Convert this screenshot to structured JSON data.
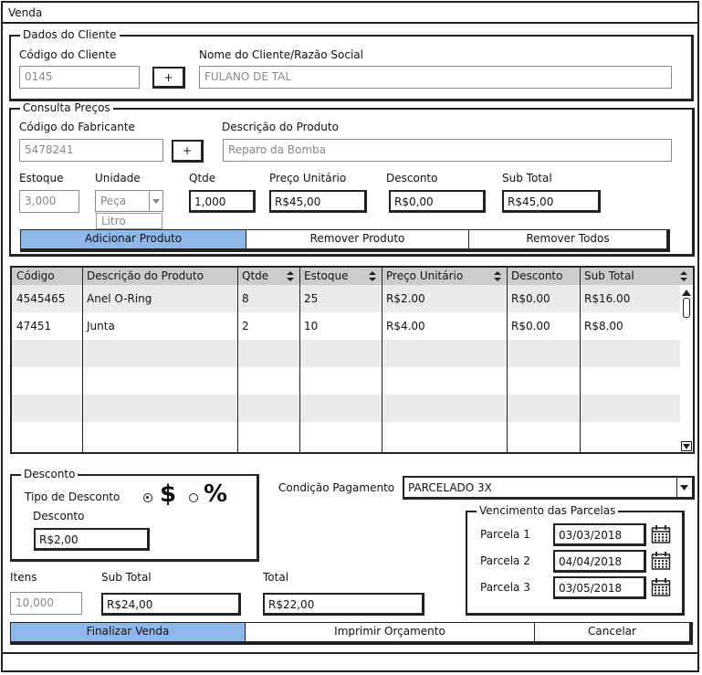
{
  "window": {
    "title": "Venda"
  },
  "cliente": {
    "legend": "Dados do Cliente",
    "codigo_label": "Código do Cliente",
    "codigo_value": "0145",
    "add_label": "+",
    "nome_label": "Nome do Cliente/Razão Social",
    "nome_value": "FULANO DE TAL"
  },
  "consulta": {
    "legend": "Consulta Preços",
    "fabricante_label": "Código do Fabricante",
    "fabricante_value": "5478241",
    "add_label": "+",
    "descricao_label": "Descrição do Produto",
    "descricao_value": "Reparo da Bomba",
    "estoque_label": "Estoque",
    "estoque_value": "3,000",
    "unidade_label": "Unidade",
    "unidade_value": "Peça",
    "unidade_option": "Litro",
    "qtde_label": "Qtde",
    "qtde_value": "1,000",
    "preco_label": "Preço Unitário",
    "preco_value": "R$45,00",
    "desconto_label": "Desconto",
    "desconto_value": "R$0,00",
    "subtotal_label": "Sub Total",
    "subtotal_value": "R$45,00",
    "actions": [
      "Adicionar Produto",
      "Remover Produto",
      "Remover Todos"
    ]
  },
  "grid": {
    "columns": [
      "Código",
      "Descrição do Produto",
      "Qtde",
      "Estoque",
      "Preço Unitário",
      "Desconto",
      "Sub Total"
    ],
    "rows": [
      [
        "4545465",
        "Anel O-Ring",
        "8",
        "25",
        "R$2.00",
        "R$0.00",
        "R$16.00"
      ],
      [
        "47451",
        "Junta",
        "2",
        "10",
        "R$4.00",
        "R$0.00",
        "R$8.00"
      ]
    ]
  },
  "desconto": {
    "legend": "Desconto",
    "tipo_label": "Tipo de Desconto",
    "dollar_symbol": "$",
    "percent_symbol": "%",
    "desconto_label": "Desconto",
    "desconto_value": "R$2,00"
  },
  "pagamento": {
    "label": "Condição Pagamento",
    "value": "PARCELADO 3X"
  },
  "parcelas": {
    "legend": "Vencimento das Parcelas",
    "items": [
      {
        "label": "Parcela 1",
        "date": "03/03/2018"
      },
      {
        "label": "Parcela 2",
        "date": "04/04/2018"
      },
      {
        "label": "Parcela 3",
        "date": "03/05/2018"
      }
    ]
  },
  "totais": {
    "itens_label": "Itens",
    "itens_value": "10,000",
    "subtotal_label": "Sub Total",
    "subtotal_value": "R$24,00",
    "total_label": "Total",
    "total_value": "R$22,00"
  },
  "footer": {
    "actions": [
      "Finalizar Venda",
      "Imprimir Orçamento",
      "Cancelar"
    ]
  },
  "colors": {
    "selected": "#8fb7ea",
    "header": "#cccccc",
    "stripe": "#ebebeb"
  }
}
